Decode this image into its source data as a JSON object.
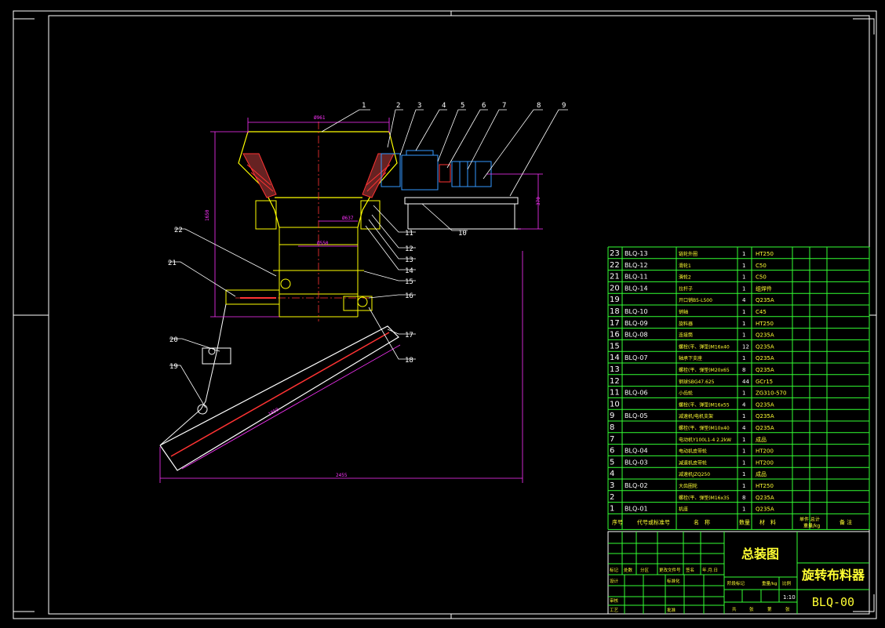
{
  "colors": {
    "background": "#000000",
    "frame": "#ffffff",
    "table_lines": "#33ff33",
    "text_white": "#ffffff",
    "text_yellow": "#ffff33",
    "dimension": "#ff33ff",
    "part_outline": "#ffff00",
    "hatch": "#ff3333",
    "centerline": "#ff3333",
    "equipment": "#3399ff",
    "leaders": "#ffffff"
  },
  "balloons": [
    "1",
    "2",
    "3",
    "4",
    "5",
    "6",
    "7",
    "8",
    "9",
    "10",
    "11",
    "12",
    "13",
    "14",
    "15",
    "16",
    "17",
    "18",
    "19",
    "20",
    "21",
    "22"
  ],
  "dimensions": {
    "top_width": "Ø961",
    "height_left": "1650",
    "inner_dia": "Ø637",
    "mid_dia": "Ø550",
    "right_height": "370",
    "chute_length": "1850",
    "bottom_length": "2455"
  },
  "bom": [
    {
      "no": "23",
      "code": "BLQ-13",
      "name": "链轮外圈",
      "qty": "1",
      "mat": "HT250"
    },
    {
      "no": "22",
      "code": "BLQ-12",
      "name": "滑轮1",
      "qty": "1",
      "mat": "C50"
    },
    {
      "no": "21",
      "code": "BLQ-11",
      "name": "滑轮2",
      "qty": "1",
      "mat": "C50"
    },
    {
      "no": "20",
      "code": "BLQ-14",
      "name": "拉杆子",
      "qty": "1",
      "mat": "组焊件"
    },
    {
      "no": "19",
      "code": "",
      "name": "开口销B5-L500",
      "qty": "4",
      "mat": "Q235A"
    },
    {
      "no": "18",
      "code": "BLQ-10",
      "name": "销轴",
      "qty": "1",
      "mat": "C45"
    },
    {
      "no": "17",
      "code": "BLQ-09",
      "name": "旋料器",
      "qty": "1",
      "mat": "HT250"
    },
    {
      "no": "16",
      "code": "BLQ-08",
      "name": "连接筒",
      "qty": "1",
      "mat": "Q235A"
    },
    {
      "no": "15",
      "code": "",
      "name": "螺栓(平、弹垫)M16x40",
      "qty": "12",
      "mat": "Q235A"
    },
    {
      "no": "14",
      "code": "BLQ-07",
      "name": "轴承下支座",
      "qty": "1",
      "mat": "Q235A"
    },
    {
      "no": "13",
      "code": "",
      "name": "螺栓(平、弹垫)M20x65",
      "qty": "8",
      "mat": "Q235A"
    },
    {
      "no": "12",
      "code": "",
      "name": "钢球SBG47.625",
      "qty": "44",
      "mat": "GCr15"
    },
    {
      "no": "11",
      "code": "BLQ-06",
      "name": "小齿轮",
      "qty": "1",
      "mat": "ZG310-570"
    },
    {
      "no": "10",
      "code": "",
      "name": "螺栓(平、弹垫)M16x55",
      "qty": "4",
      "mat": "Q235A"
    },
    {
      "no": "9",
      "code": "BLQ-05",
      "name": "减速机/电机支架",
      "qty": "1",
      "mat": "Q235A"
    },
    {
      "no": "8",
      "code": "",
      "name": "螺栓(平、弹垫)M10x40",
      "qty": "4",
      "mat": "Q235A"
    },
    {
      "no": "7",
      "code": "",
      "name": "电动机Y100L1-4 2.2kW",
      "qty": "1",
      "mat": "成品"
    },
    {
      "no": "6",
      "code": "BLQ-04",
      "name": "电动机皮带轮",
      "qty": "1",
      "mat": "HT200"
    },
    {
      "no": "5",
      "code": "BLQ-03",
      "name": "减速机皮带轮",
      "qty": "1",
      "mat": "HT200"
    },
    {
      "no": "4",
      "code": "",
      "name": "减速机JZQ250",
      "qty": "1",
      "mat": "成品"
    },
    {
      "no": "3",
      "code": "BLQ-02",
      "name": "大齿圈轮",
      "qty": "1",
      "mat": "HT250"
    },
    {
      "no": "2",
      "code": "",
      "name": "螺栓(平、弹垫)M16x35",
      "qty": "8",
      "mat": "Q235A"
    },
    {
      "no": "1",
      "code": "BLQ-01",
      "name": "机座",
      "qty": "1",
      "mat": "Q235A"
    }
  ],
  "bom_header": {
    "no": "序号",
    "code": "代号或标准号",
    "name": "名　称",
    "qty": "数量",
    "mat": "材　料",
    "weight": "单件 总计",
    "weight_unit": "重量/kg",
    "note": "备 注"
  },
  "title_block": {
    "drawing_title": "总装图",
    "product_name": "旋转布料器",
    "drawing_no": "BLQ-00",
    "scale": "1:10",
    "rev_labels": [
      "标记",
      "处数",
      "分区",
      "更改文件号",
      "签名",
      "年.月.日"
    ],
    "role_design": "设计",
    "standardize": "标准化",
    "role_review": "审核",
    "role_process": "工艺",
    "approve": "批准",
    "stage_labels": [
      "阶段标记",
      "重量/kg",
      "比例"
    ],
    "sheet_labels": [
      "共",
      "张",
      "第",
      "张"
    ]
  }
}
